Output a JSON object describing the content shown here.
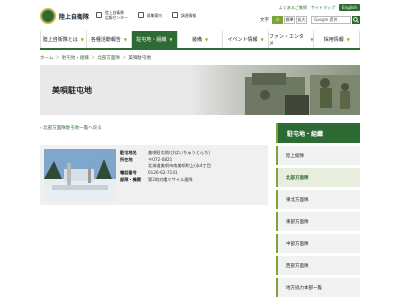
{
  "header": {
    "logo_text": "陸上自衛隊",
    "links": [
      {
        "line1": "陸上自衛隊",
        "line2": "広報センター"
      },
      {
        "line1": "募集案内",
        "line2": ""
      },
      {
        "line1": "調達情報",
        "line2": ""
      }
    ],
    "top_links": [
      "よくあるご質問",
      "サイトマップ"
    ],
    "english_label": "English",
    "font_size_label": "文字",
    "font_sizes": [
      "小",
      "標準",
      "拡大"
    ],
    "search_placeholder": "Google 提供"
  },
  "nav": {
    "items": [
      {
        "label": "陸上自衛隊とは"
      },
      {
        "label": "各種活動報告"
      },
      {
        "label": "駐屯地・組織"
      },
      {
        "label": "装備"
      },
      {
        "label": "イベント情報"
      },
      {
        "label": "ファン・エンタメ"
      },
      {
        "label": "採用情報"
      }
    ],
    "active_index": 2
  },
  "breadcrumb": {
    "items": [
      "ホーム",
      "駐屯地・組織",
      "北部方面隊"
    ],
    "current": "美唄駐屯地"
  },
  "banner": {
    "title": "美唄駐屯地"
  },
  "back_link": "北部方面隊駐屯地一覧へ戻る",
  "info": {
    "rows": [
      {
        "key": "駐屯地名",
        "value": "美唄駐屯地(びばいちゅうとんち)"
      },
      {
        "key": "所在地",
        "value": "〒072-0821"
      },
      {
        "key": "",
        "value": "北海道美唄市南美唄町上(永4丁目"
      },
      {
        "key": "電話番号",
        "value": "0126-62-7141"
      },
      {
        "key": "部隊・機関",
        "value": "第2地対艦ミサイル連隊"
      }
    ]
  },
  "sidebar": {
    "title": "駐屯地・組織",
    "items": [
      {
        "label": "陸上総隊"
      },
      {
        "label": "北部方面隊"
      },
      {
        "label": "東北方面隊"
      },
      {
        "label": "東部方面隊"
      },
      {
        "label": "中部方面隊"
      },
      {
        "label": "西部方面隊"
      },
      {
        "label": "地方協力本部一覧"
      }
    ],
    "current_index": 1
  },
  "colors": {
    "brand_green": "#2e6b34",
    "accent_lime": "#7ea338"
  }
}
